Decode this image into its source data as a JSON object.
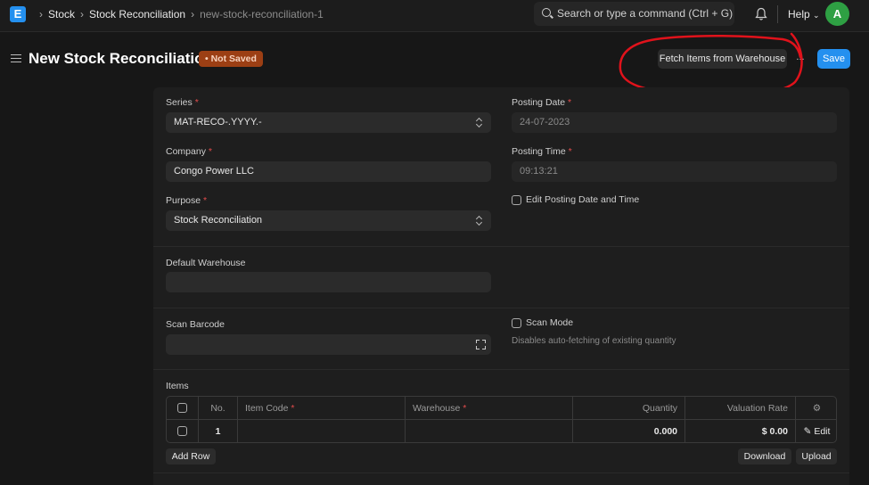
{
  "navbar": {
    "logo_letter": "E",
    "breadcrumbs": [
      "Stock",
      "Stock Reconciliation",
      "new-stock-reconciliation-1"
    ],
    "search_placeholder": "Search or type a command (Ctrl + G)",
    "help_label": "Help",
    "avatar_letter": "A"
  },
  "header": {
    "title": "New Stock Reconciliation",
    "status_badge": "Not Saved",
    "fetch_button": "Fetch Items from Warehouse",
    "more_button": "...",
    "save_button": "Save"
  },
  "form": {
    "series": {
      "label": "Series",
      "value": "MAT-RECO-.YYYY.-"
    },
    "company": {
      "label": "Company",
      "value": "Congo Power LLC"
    },
    "purpose": {
      "label": "Purpose",
      "value": "Stock Reconciliation"
    },
    "posting_date": {
      "label": "Posting Date",
      "value": "24-07-2023"
    },
    "posting_time": {
      "label": "Posting Time",
      "value": "09:13:21"
    },
    "edit_posting": {
      "label": "Edit Posting Date and Time"
    },
    "default_warehouse": {
      "label": "Default Warehouse",
      "value": ""
    },
    "scan_barcode": {
      "label": "Scan Barcode",
      "value": ""
    },
    "scan_mode": {
      "label": "Scan Mode",
      "help": "Disables auto-fetching of existing quantity"
    }
  },
  "items_table": {
    "label": "Items",
    "columns": [
      "No.",
      "Item Code",
      "Warehouse",
      "Quantity",
      "Valuation Rate"
    ],
    "rows": [
      {
        "no": "1",
        "item_code": "",
        "warehouse": "",
        "quantity": "0.000",
        "valuation_rate": "$ 0.00",
        "edit": "Edit"
      }
    ],
    "add_row": "Add Row",
    "download": "Download",
    "upload": "Upload"
  },
  "colors": {
    "primary": "#2490ef",
    "badge_bg": "#9c3f14",
    "annotation": "#e0121b",
    "avatar": "#2ea043"
  }
}
